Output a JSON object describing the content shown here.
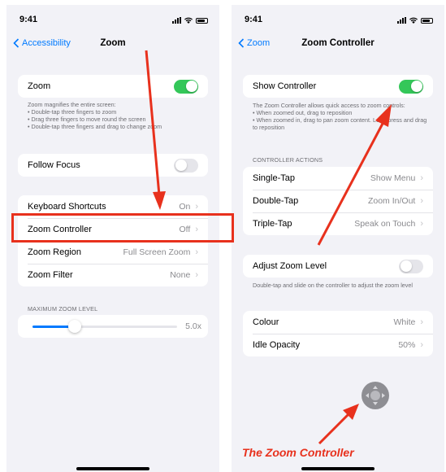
{
  "colors": {
    "accent": "#007aff",
    "toggle_on": "#34c759",
    "annotation": "#e8311d"
  },
  "left": {
    "status_time": "9:41",
    "nav": {
      "back": "Accessibility",
      "title": "Zoom"
    },
    "zoom_row": {
      "label": "Zoom",
      "on": true
    },
    "zoom_footnote": "Zoom magnifies the entire screen:\n• Double-tap three fingers to zoom\n• Drag three fingers to move round the screen\n• Double-tap three fingers and drag to change zoom",
    "follow_focus": {
      "label": "Follow Focus",
      "on": false
    },
    "settings": [
      {
        "label": "Keyboard Shortcuts",
        "value": "On"
      },
      {
        "label": "Zoom Controller",
        "value": "Off"
      },
      {
        "label": "Zoom Region",
        "value": "Full Screen Zoom"
      },
      {
        "label": "Zoom Filter",
        "value": "None"
      }
    ],
    "max_zoom": {
      "header": "MAXIMUM ZOOM LEVEL",
      "value_text": "5.0x",
      "fraction": 0.29
    }
  },
  "right": {
    "status_time": "9:41",
    "nav": {
      "back": "Zoom",
      "title": "Zoom Controller"
    },
    "show_controller": {
      "label": "Show Controller",
      "on": true
    },
    "show_footnote": "The Zoom Controller allows quick access to zoom controls:\n• When zoomed out, drag to reposition\n• When zoomed in, drag to pan zoom content. Long-press and drag to reposition",
    "actions_header": "CONTROLLER ACTIONS",
    "actions": [
      {
        "label": "Single-Tap",
        "value": "Show Menu"
      },
      {
        "label": "Double-Tap",
        "value": "Zoom In/Out"
      },
      {
        "label": "Triple-Tap",
        "value": "Speak on Touch"
      }
    ],
    "adjust_zoom": {
      "label": "Adjust Zoom Level",
      "on": false
    },
    "adjust_footnote": "Double-tap and slide on the controller to adjust the zoom level",
    "appearance": [
      {
        "label": "Colour",
        "value": "White"
      },
      {
        "label": "Idle Opacity",
        "value": "50%"
      }
    ]
  },
  "caption": "The Zoom Controller"
}
